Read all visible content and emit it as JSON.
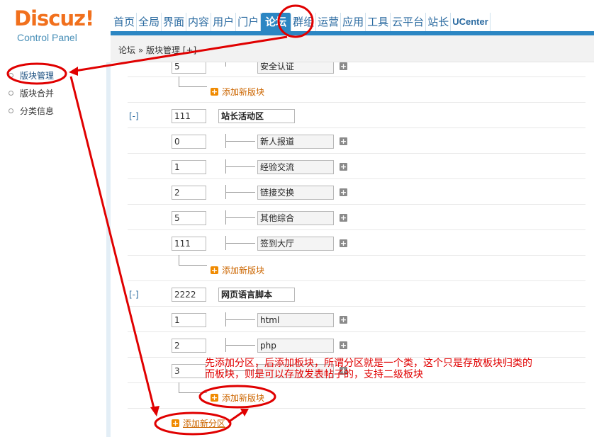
{
  "header": {
    "logo_text": "Discuz",
    "logo_bang": "!",
    "logo_sub": "Control Panel",
    "nav": [
      "首页",
      "全局",
      "界面",
      "内容",
      "用户",
      "门户",
      "论坛",
      "群组",
      "运营",
      "应用",
      "工具",
      "云平台",
      "站长",
      "UCenter"
    ],
    "active_nav": "论坛"
  },
  "breadcrumb": "论坛 » 版块管理 [+]",
  "sidebar": {
    "items": [
      "版块管理",
      "版块合并",
      "分类信息"
    ]
  },
  "forum": {
    "toggle": "[-]",
    "top_partial": {
      "order": "5",
      "name": "安全认证"
    },
    "add_board": "添加新版块",
    "add_category": "添加新分区",
    "categories": [
      {
        "order": "111",
        "name": "站长活动区",
        "boards": [
          {
            "order": "0",
            "name": "新人报道"
          },
          {
            "order": "1",
            "name": "经验交流"
          },
          {
            "order": "2",
            "name": "链接交换"
          },
          {
            "order": "5",
            "name": "其他综合"
          },
          {
            "order": "111",
            "name": "签到大厅"
          }
        ]
      },
      {
        "order": "2222",
        "name": "网页语言脚本",
        "boards": [
          {
            "order": "1",
            "name": "html"
          },
          {
            "order": "2",
            "name": "php"
          },
          {
            "order": "3",
            "name": ""
          }
        ]
      }
    ]
  },
  "annotation": {
    "line1": "先添加分区，后添加板块，所谓分区就是一个类，这个只是存放板块归类的",
    "line2": "而板块，则是可以存放发表帖子的，支持二级板块",
    "color": "#e00000"
  }
}
